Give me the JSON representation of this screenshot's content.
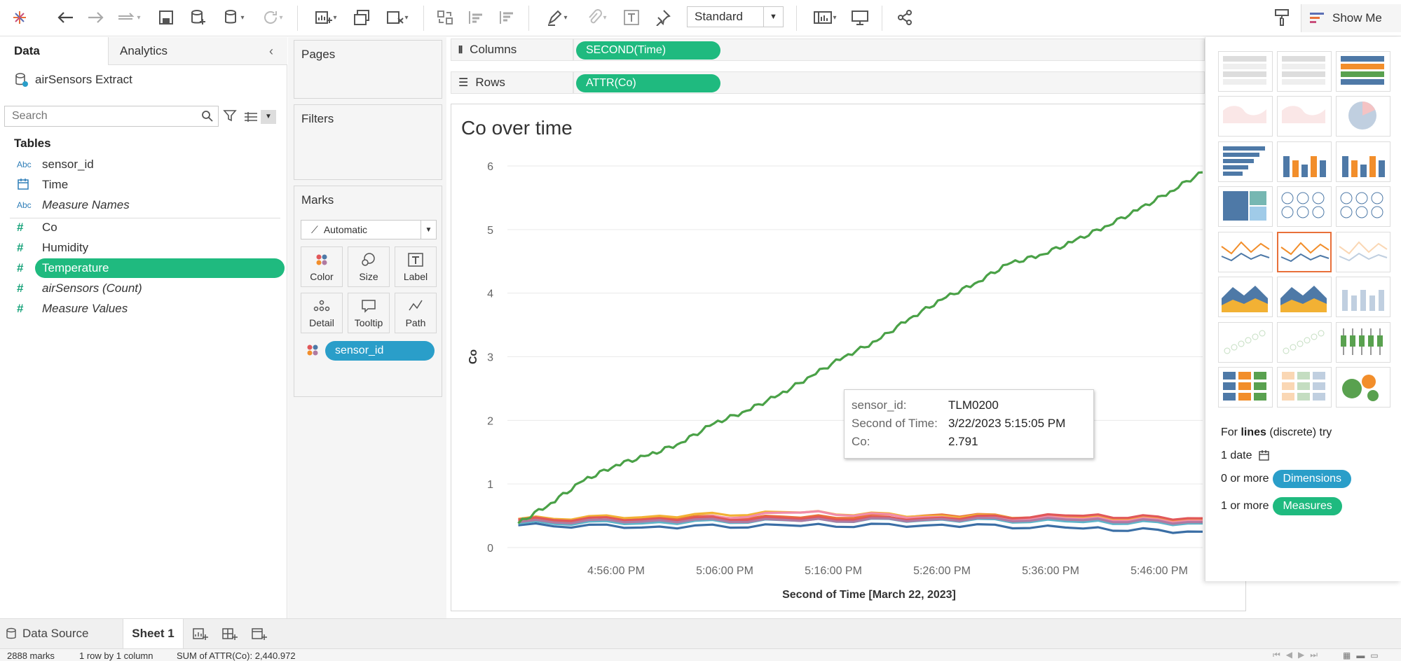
{
  "toolbar": {
    "standard_label": "Standard",
    "show_me_label": "Show Me"
  },
  "left": {
    "tabs": [
      "Data",
      "Analytics"
    ],
    "datasource": "airSensors Extract",
    "search_placeholder": "Search",
    "tables_header": "Tables",
    "fields": [
      {
        "type": "Abc",
        "name": "sensor_id"
      },
      {
        "type": "date",
        "name": "Time"
      },
      {
        "type": "Abc",
        "name": "Measure Names"
      },
      {
        "type": "#",
        "name": "Co"
      },
      {
        "type": "#",
        "name": "Humidity"
      },
      {
        "type": "#",
        "name": "Temperature"
      },
      {
        "type": "#",
        "name": "airSensors (Count)"
      },
      {
        "type": "#",
        "name": "Measure Values"
      }
    ]
  },
  "cards": {
    "pages": "Pages",
    "filters": "Filters",
    "marks": "Marks",
    "mark_type": "Automatic",
    "buttons": [
      "Color",
      "Size",
      "Label",
      "Detail",
      "Tooltip",
      "Path"
    ],
    "color_pill": "sensor_id"
  },
  "shelves": {
    "columns_label": "Columns",
    "rows_label": "Rows",
    "columns_pill": "SECOND(Time)",
    "rows_pill": "ATTR(Co)"
  },
  "tooltip": {
    "rows": [
      {
        "label": "sensor_id:",
        "value": "TLM0200"
      },
      {
        "label": "Second of Time:",
        "value": "3/22/2023 5:15:05 PM"
      },
      {
        "label": "Co:",
        "value": "2.791"
      }
    ]
  },
  "showme": {
    "hint_prefix": "For ",
    "hint_bold": "lines",
    "hint_suffix": " (discrete) try",
    "req1": "1 date",
    "req2_prefix": "0 or more",
    "req2_pill": "Dimensions",
    "req3_prefix": "1 or more",
    "req3_pill": "Measures"
  },
  "bottom": {
    "datasource_tab": "Data Source",
    "sheet_tab": "Sheet 1"
  },
  "status": {
    "marks": "2888 marks",
    "dims": "1 row by 1 column",
    "sum": "SUM of ATTR(Co): 2,440.972"
  },
  "colors": {
    "pill_green": "#1fba7f",
    "pill_blue": "#2a9ec9",
    "highlight_orange": "#e8703a"
  },
  "chart_data": {
    "type": "line",
    "title": "Co over time",
    "xlabel": "Second of Time [March 22, 2023]",
    "ylabel": "Co",
    "x_ticks": [
      "4:56:00 PM",
      "5:06:00 PM",
      "5:16:00 PM",
      "5:26:00 PM",
      "5:36:00 PM",
      "5:46:00 PM"
    ],
    "y_ticks": [
      0,
      1,
      2,
      3,
      4,
      5,
      6
    ],
    "ylim": [
      0,
      6
    ],
    "xlim": [
      "4:46:00 PM",
      "5:50:00 PM"
    ],
    "grid": true,
    "series": [
      {
        "color": "#4aa147",
        "x": [
          "4:47:00 PM",
          "4:50:00 PM",
          "4:53:00 PM",
          "4:56:00 PM",
          "4:59:00 PM",
          "5:02:00 PM",
          "5:05:00 PM",
          "5:08:00 PM",
          "5:11:00 PM",
          "5:14:00 PM",
          "5:17:00 PM",
          "5:20:00 PM",
          "5:23:00 PM",
          "5:26:00 PM",
          "5:29:00 PM",
          "5:32:00 PM",
          "5:35:00 PM",
          "5:38:00 PM",
          "5:41:00 PM",
          "5:44:00 PM",
          "5:47:00 PM",
          "5:50:00 PM"
        ],
        "values": [
          0.38,
          0.7,
          1.05,
          1.3,
          1.45,
          1.65,
          1.95,
          2.15,
          2.4,
          2.7,
          3.0,
          3.25,
          3.6,
          3.9,
          4.15,
          4.45,
          4.6,
          4.8,
          5.05,
          5.3,
          5.6,
          5.9
        ]
      },
      {
        "color": "#e8703a",
        "x": [
          "4:47:00 PM",
          "5:00:00 PM",
          "5:13:00 PM",
          "5:26:00 PM",
          "5:39:00 PM",
          "5:50:00 PM"
        ],
        "values": [
          0.42,
          0.48,
          0.47,
          0.52,
          0.46,
          0.44
        ]
      },
      {
        "color": "#3a6ea5",
        "x": [
          "4:47:00 PM",
          "5:00:00 PM",
          "5:13:00 PM",
          "5:26:00 PM",
          "5:39:00 PM",
          "5:50:00 PM"
        ],
        "values": [
          0.35,
          0.33,
          0.34,
          0.36,
          0.3,
          0.25
        ]
      },
      {
        "color": "#f2b134",
        "x": [
          "4:47:00 PM",
          "5:00:00 PM",
          "5:13:00 PM",
          "5:26:00 PM",
          "5:39:00 PM",
          "5:50:00 PM"
        ],
        "values": [
          0.45,
          0.5,
          0.55,
          0.5,
          0.48,
          0.45
        ]
      },
      {
        "color": "#f28ca8",
        "x": [
          "4:47:00 PM",
          "5:00:00 PM",
          "5:13:00 PM",
          "5:26:00 PM",
          "5:39:00 PM",
          "5:50:00 PM"
        ],
        "values": [
          0.4,
          0.42,
          0.55,
          0.48,
          0.45,
          0.42
        ]
      },
      {
        "color": "#5fb4c9",
        "x": [
          "4:47:00 PM",
          "5:00:00 PM",
          "5:13:00 PM",
          "5:26:00 PM",
          "5:39:00 PM",
          "5:50:00 PM"
        ],
        "values": [
          0.38,
          0.4,
          0.42,
          0.44,
          0.4,
          0.38
        ]
      },
      {
        "color": "#e15759",
        "x": [
          "4:47:00 PM",
          "5:00:00 PM",
          "5:13:00 PM",
          "5:26:00 PM",
          "5:39:00 PM",
          "5:50:00 PM"
        ],
        "values": [
          0.44,
          0.46,
          0.45,
          0.47,
          0.5,
          0.46
        ]
      },
      {
        "color": "#b07aa1",
        "x": [
          "4:47:00 PM",
          "5:00:00 PM",
          "5:13:00 PM",
          "5:26:00 PM",
          "5:39:00 PM",
          "5:50:00 PM"
        ],
        "values": [
          0.4,
          0.43,
          0.42,
          0.45,
          0.43,
          0.4
        ]
      }
    ]
  }
}
